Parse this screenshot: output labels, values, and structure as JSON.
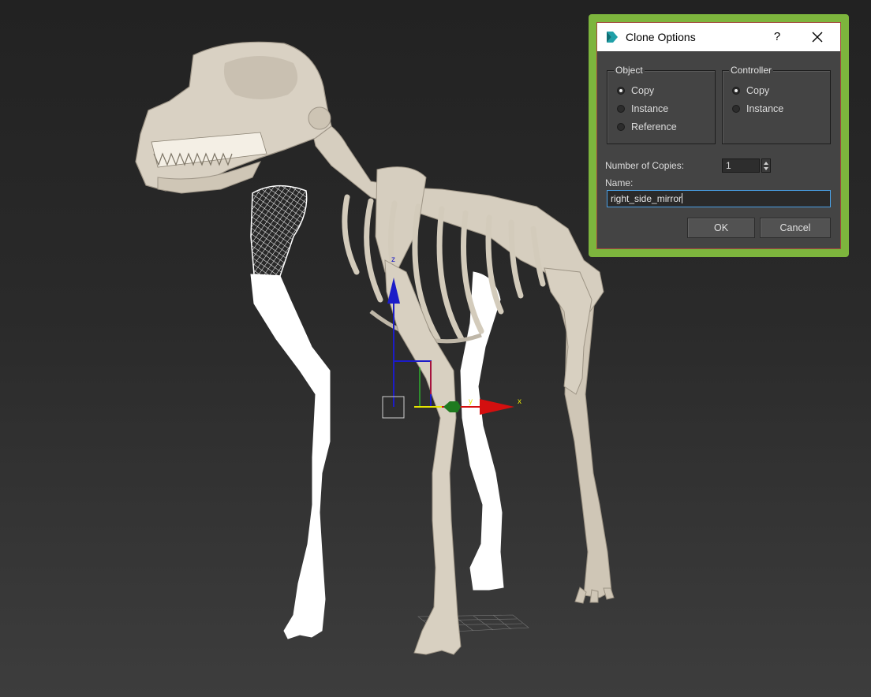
{
  "viewport": {
    "axis_labels": {
      "x": "x",
      "y": "y",
      "z": "z"
    },
    "colors": {
      "bone": "#d8d0c1",
      "bone_shadow": "#a79e8f",
      "selected": "#ffffff",
      "axis_x": "#d40f0f",
      "axis_y": "#2fae2f",
      "axis_z": "#1c1cc8",
      "gizmo_yellow": "#e6e600"
    }
  },
  "dialog": {
    "title": "Clone Options",
    "help_label": "?",
    "frame_color": "#7db53d",
    "object_group": {
      "legend": "Object",
      "options": [
        {
          "label": "Copy",
          "checked": true
        },
        {
          "label": "Instance",
          "checked": false
        },
        {
          "label": "Reference",
          "checked": false
        }
      ]
    },
    "controller_group": {
      "legend": "Controller",
      "options": [
        {
          "label": "Copy",
          "checked": true
        },
        {
          "label": "Instance",
          "checked": false
        }
      ]
    },
    "copies_label": "Number of Copies:",
    "copies_value": "1",
    "name_label": "Name:",
    "name_value": "right_side_mirror",
    "ok_label": "OK",
    "cancel_label": "Cancel"
  }
}
